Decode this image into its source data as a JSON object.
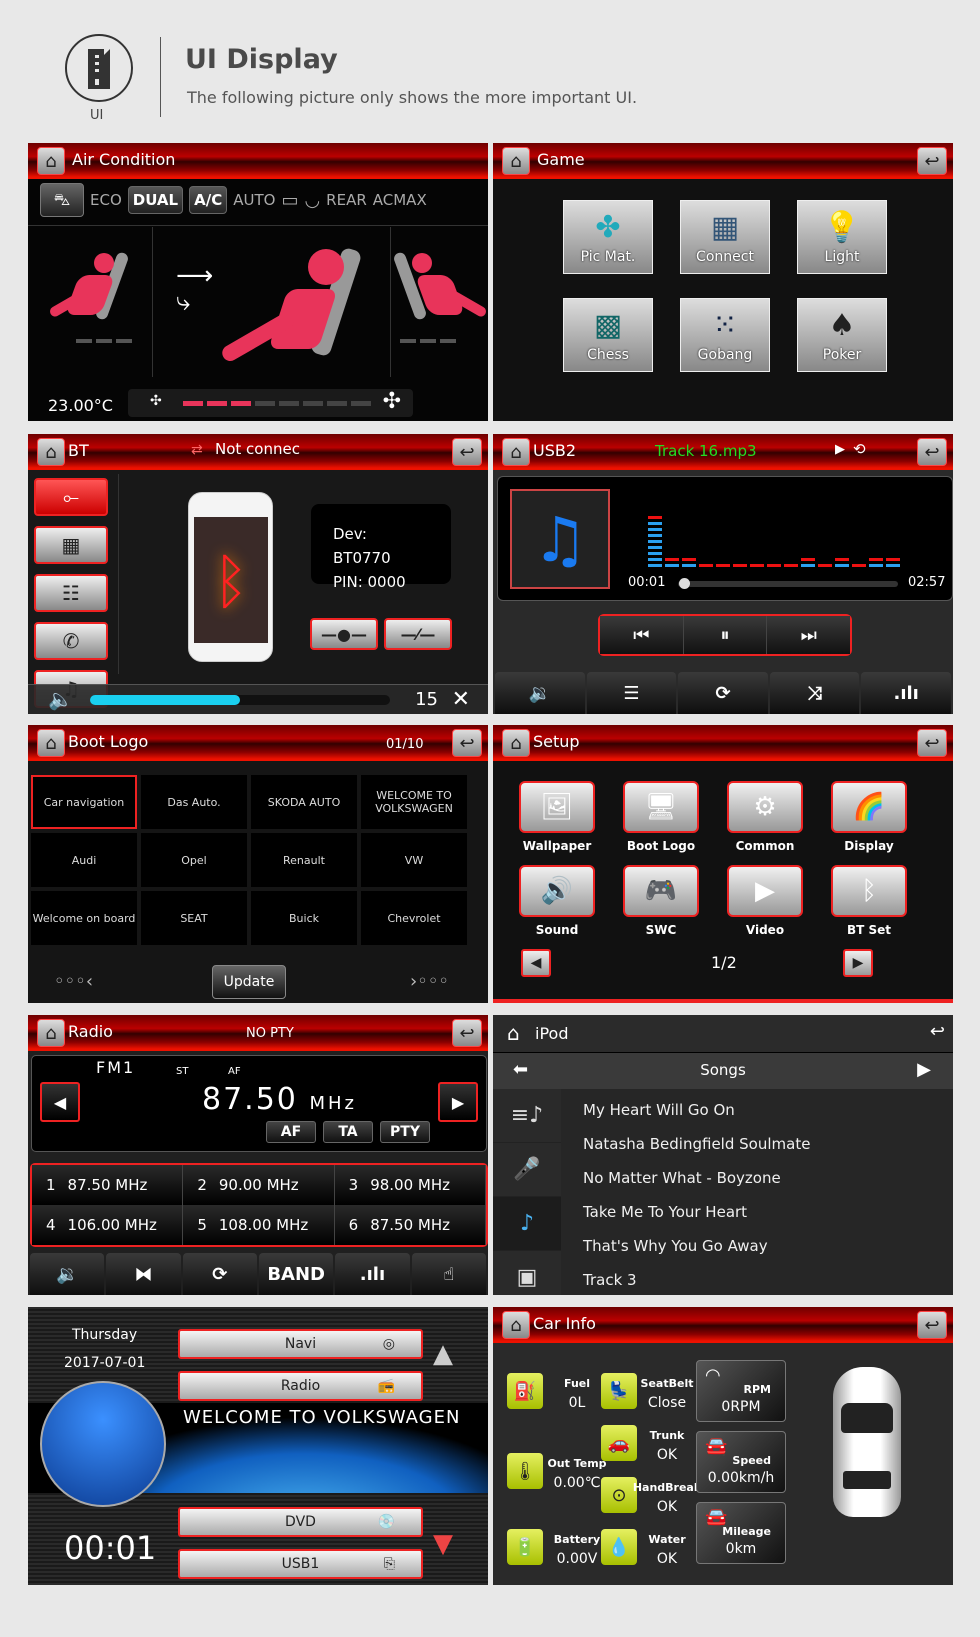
{
  "header": {
    "icon": "zip-file-icon",
    "icon_caption": "UI",
    "title": "UI Display",
    "subtitle": "The following picture only shows the more important UI."
  },
  "air_condition": {
    "title": "Air Condition",
    "modes": [
      "ECO",
      "DUAL",
      "A/C",
      "AUTO",
      "REAR",
      "ACMAX"
    ],
    "active_modes": [
      "DUAL",
      "A/C"
    ],
    "temperature": "23.00°C",
    "fan_level": 3,
    "fan_max": 8,
    "accent": "#e8345a"
  },
  "game": {
    "title": "Game",
    "items": [
      {
        "label": "Pic Mat.",
        "icon": "puzzle-icon"
      },
      {
        "label": "Connect",
        "icon": "tiles-icon"
      },
      {
        "label": "Light",
        "icon": "bulb-icon"
      },
      {
        "label": "Chess",
        "icon": "chess-board-icon"
      },
      {
        "label": "Gobang",
        "icon": "gobang-board-icon"
      },
      {
        "label": "Poker",
        "icon": "cards-icon"
      }
    ]
  },
  "bt": {
    "title": "BT",
    "status": "Not connec",
    "device": "Dev: BT0770",
    "pin": "PIN: 0000",
    "volume_value": "15",
    "volume_fraction": 0.5
  },
  "usb": {
    "title": "USB2",
    "track": "Track 16.mp3",
    "elapsed": "00:01",
    "total": "02:57",
    "progress_fraction": 0.006,
    "track_color": "#22dd22"
  },
  "boot_logo": {
    "title": "Boot Logo",
    "page": "01/10",
    "update_label": "Update",
    "logos": [
      "Car navigation",
      "Das Auto.",
      "SKODA AUTO",
      "WELCOME TO VOLKSWAGEN",
      "Audi",
      "Opel",
      "Renault",
      "VW",
      "Welcome on board",
      "SEAT",
      "Buick",
      "Chevrolet"
    ]
  },
  "setup": {
    "title": "Setup",
    "page": "1/2",
    "items": [
      {
        "label": "Wallpaper",
        "icon": "wallpaper-icon"
      },
      {
        "label": "Boot Logo",
        "icon": "monitor-icon"
      },
      {
        "label": "Common",
        "icon": "gear-icon"
      },
      {
        "label": "Display",
        "icon": "display-icon"
      },
      {
        "label": "Sound",
        "icon": "speaker-icon"
      },
      {
        "label": "SWC",
        "icon": "steering-wheel-icon"
      },
      {
        "label": "Video",
        "icon": "video-icon"
      },
      {
        "label": "BT Set",
        "icon": "bluetooth-icon"
      }
    ]
  },
  "radio": {
    "title": "Radio",
    "pty": "NO PTY",
    "band": "FM1",
    "st": "ST",
    "af_ind": "AF",
    "frequency": "87.50",
    "unit": "MHz",
    "tags": [
      "AF",
      "TA",
      "PTY"
    ],
    "presets": [
      {
        "n": "1",
        "f": "87.50 MHz"
      },
      {
        "n": "2",
        "f": "90.00 MHz"
      },
      {
        "n": "3",
        "f": "98.00 MHz"
      },
      {
        "n": "4",
        "f": "106.00 MHz"
      },
      {
        "n": "5",
        "f": "108.00 MHz"
      },
      {
        "n": "6",
        "f": "87.50 MHz"
      }
    ],
    "band_label": "BAND"
  },
  "ipod": {
    "title": "iPod",
    "section": "Songs",
    "songs": [
      "My Heart Will Go On",
      "Natasha Bedingfield  Soulmate",
      "No Matter What - Boyzone",
      "Take Me To Your Heart",
      "That's Why You Go Away",
      "Track  3"
    ]
  },
  "home": {
    "day": "Thursday",
    "date": "2017-07-01",
    "time": "00:01",
    "welcome": "WELCOME TO VOLKSWAGEN",
    "buttons": [
      "Navi",
      "Radio",
      "DVD",
      "USB1"
    ]
  },
  "car_info": {
    "title": "Car Info",
    "fuel": {
      "label": "Fuel",
      "value": "0L"
    },
    "seatbelt": {
      "label": "SeatBelt",
      "value": "Close"
    },
    "trunk": {
      "label": "Trunk",
      "value": "OK"
    },
    "out_temp": {
      "label": "Out Temp",
      "value": "0.00℃"
    },
    "handbreak": {
      "label": "HandBreak",
      "value": "OK"
    },
    "battery": {
      "label": "Battery",
      "value": "0.00V"
    },
    "water": {
      "label": "Water",
      "value": "OK"
    },
    "rpm": {
      "label": "RPM",
      "value": "0RPM"
    },
    "speed": {
      "label": "Speed",
      "value": "0.00km/h"
    },
    "mileage": {
      "label": "Mileage",
      "value": "0km"
    }
  }
}
